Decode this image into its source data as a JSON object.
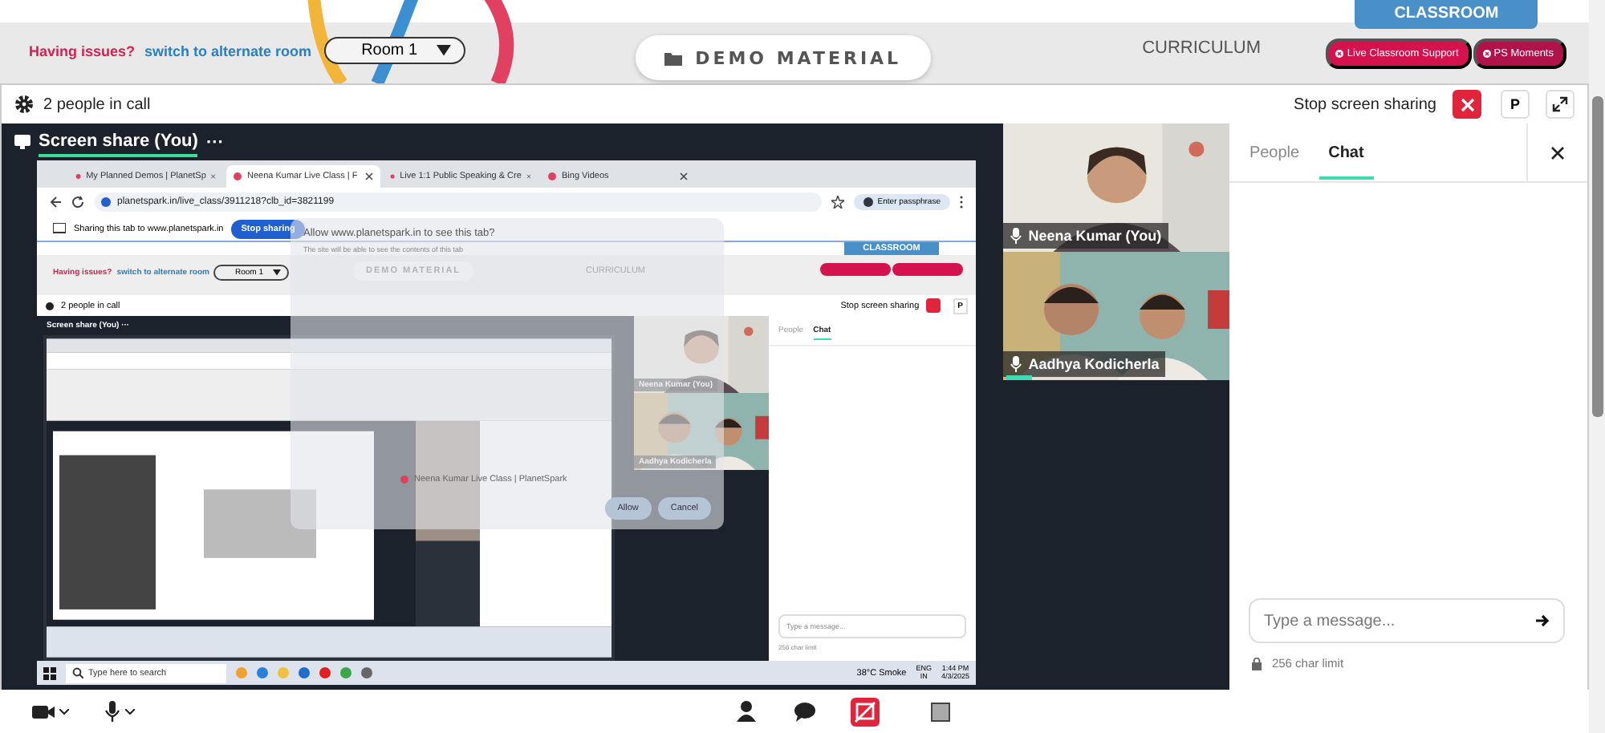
{
  "top_bar": {
    "issue_label": "Having issues?",
    "issue_link": "switch to alternate room",
    "room": "Room 1",
    "demo_button": "DEMO MATERIAL",
    "curriculum_tab": "CURRICULUM",
    "classroom_tab": "CLASSROOM",
    "badges": [
      {
        "label": "Live Classroom Support"
      },
      {
        "label": "PS Moments"
      }
    ]
  },
  "call_header": {
    "people_count": "2 people in call",
    "stop_sharing": "Stop screen sharing",
    "p_button": "P"
  },
  "screen_share": {
    "title": "Screen share (You)",
    "more": "···",
    "browser": {
      "tabs": [
        {
          "label": "My Planned Demos | PlanetSp",
          "selected": false
        },
        {
          "label": "Neena Kumar Live Class | F",
          "selected": true
        },
        {
          "label": "Live 1:1 Public Speaking & Cre",
          "selected": false
        },
        {
          "label": "Bing Videos",
          "selected": false
        }
      ],
      "url": "planetspark.in/live_class/3911218?clb_id=3821199",
      "passphrase": "Enter passphrase",
      "sharing_notice": "Sharing this tab to www.planetspark.in",
      "stop_sharing": "Stop sharing",
      "page": {
        "issue_label": "Having issues?",
        "issue_link": "switch to alternate room",
        "room": "Room 1",
        "demo_button": "DEMO MATERIAL",
        "curriculum_tab": "CURRICULUM",
        "classroom_tab": "CLASSROOM",
        "people_count": "2 people in call",
        "stop_sharing": "Stop screen sharing",
        "p_button": "P",
        "share_title": "Screen share (You) ···",
        "video_tiles": [
          {
            "name": "Neena Kumar (You)"
          },
          {
            "name": "Aadhya Kodicherla"
          }
        ],
        "chat_tabs": [
          {
            "label": "People",
            "selected": false
          },
          {
            "label": "Chat",
            "selected": true
          }
        ],
        "message_placeholder": "Type a message...",
        "limit": "256 char limit"
      },
      "dialog": {
        "title": "Allow www.planetspark.in to see this tab?",
        "subtitle": "The site will be able to see the contents of this tab",
        "tab_name": "Neena Kumar Live Class | PlanetSpark",
        "buttons": [
          "Allow",
          "Cancel"
        ]
      },
      "taskbar": {
        "search": "Type here to search",
        "weather": "38°C  Smoke",
        "lang": "ENG",
        "region": "IN",
        "time": "1:44 PM",
        "date": "4/3/2025"
      }
    }
  },
  "video_tiles": [
    {
      "name": "Neena Kumar (You)",
      "speaking": false
    },
    {
      "name": "Aadhya Kodicherla",
      "speaking": true
    }
  ],
  "chat_panel": {
    "tabs": [
      {
        "label": "People",
        "selected": false
      },
      {
        "label": "Chat",
        "selected": true
      }
    ],
    "input": {
      "placeholder": "Type a message..."
    },
    "limit": "256 char limit"
  }
}
